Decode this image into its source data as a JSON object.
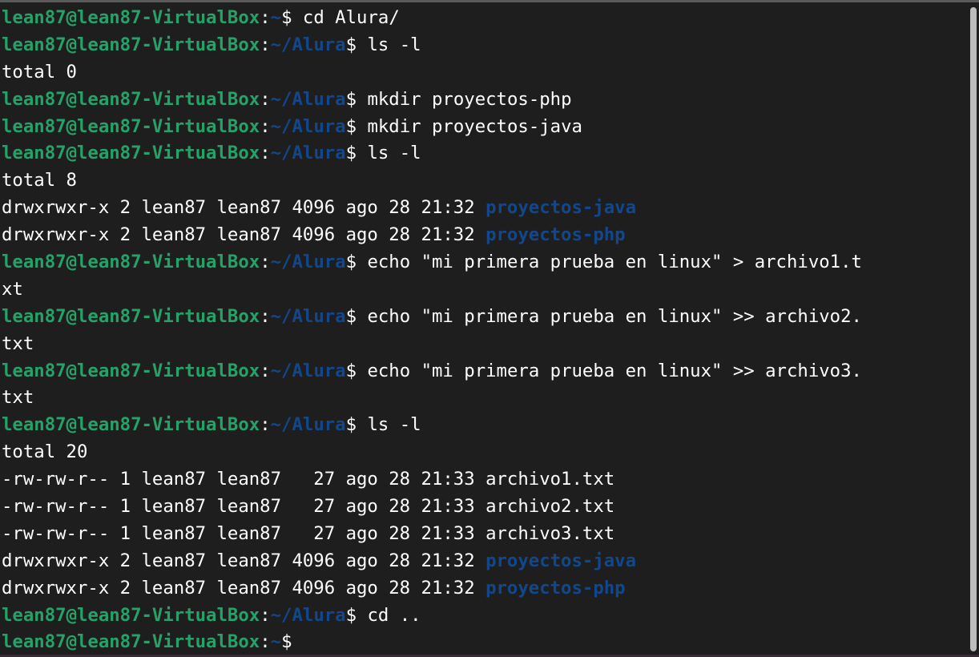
{
  "prompt": {
    "user_host": "lean87@lean87-VirtualBox",
    "colon": ":",
    "home_path": "~",
    "alura_path": "~/Alura",
    "dollar": "$"
  },
  "lines": [
    {
      "type": "prompt",
      "path": "~",
      "command": " cd Alura/"
    },
    {
      "type": "prompt",
      "path": "~/Alura",
      "command": " ls -l"
    },
    {
      "type": "output",
      "text": "total 0"
    },
    {
      "type": "prompt",
      "path": "~/Alura",
      "command": " mkdir proyectos-php"
    },
    {
      "type": "prompt",
      "path": "~/Alura",
      "command": " mkdir proyectos-java"
    },
    {
      "type": "prompt",
      "path": "~/Alura",
      "command": " ls -l"
    },
    {
      "type": "output",
      "text": "total 8"
    },
    {
      "type": "entry",
      "meta": "drwxrwxr-x 2 lean87 lean87 4096 ago 28 21:32 ",
      "name": "proyectos-java",
      "is_dir": true
    },
    {
      "type": "entry",
      "meta": "drwxrwxr-x 2 lean87 lean87 4096 ago 28 21:32 ",
      "name": "proyectos-php",
      "is_dir": true
    },
    {
      "type": "prompt",
      "path": "~/Alura",
      "command": " echo \"mi primera prueba en linux\" > archivo1.t"
    },
    {
      "type": "output",
      "text": "xt"
    },
    {
      "type": "prompt",
      "path": "~/Alura",
      "command": " echo \"mi primera prueba en linux\" >> archivo2."
    },
    {
      "type": "output",
      "text": "txt"
    },
    {
      "type": "prompt",
      "path": "~/Alura",
      "command": " echo \"mi primera prueba en linux\" >> archivo3."
    },
    {
      "type": "output",
      "text": "txt"
    },
    {
      "type": "prompt",
      "path": "~/Alura",
      "command": " ls -l"
    },
    {
      "type": "output",
      "text": "total 20"
    },
    {
      "type": "entry",
      "meta": "-rw-rw-r-- 1 lean87 lean87   27 ago 28 21:33 ",
      "name": "archivo1.txt",
      "is_dir": false
    },
    {
      "type": "entry",
      "meta": "-rw-rw-r-- 1 lean87 lean87   27 ago 28 21:33 ",
      "name": "archivo2.txt",
      "is_dir": false
    },
    {
      "type": "entry",
      "meta": "-rw-rw-r-- 1 lean87 lean87   27 ago 28 21:33 ",
      "name": "archivo3.txt",
      "is_dir": false
    },
    {
      "type": "entry",
      "meta": "drwxrwxr-x 2 lean87 lean87 4096 ago 28 21:32 ",
      "name": "proyectos-java",
      "is_dir": true
    },
    {
      "type": "entry",
      "meta": "drwxrwxr-x 2 lean87 lean87 4096 ago 28 21:32 ",
      "name": "proyectos-php",
      "is_dir": true
    },
    {
      "type": "prompt",
      "path": "~/Alura",
      "command": " cd .."
    },
    {
      "type": "prompt",
      "path": "~",
      "command": ""
    }
  ],
  "colors": {
    "background": "#1e1e1e",
    "foreground": "#ffffff",
    "user_host": "#26a269",
    "path": "#12488b",
    "directory": "#12488b"
  }
}
